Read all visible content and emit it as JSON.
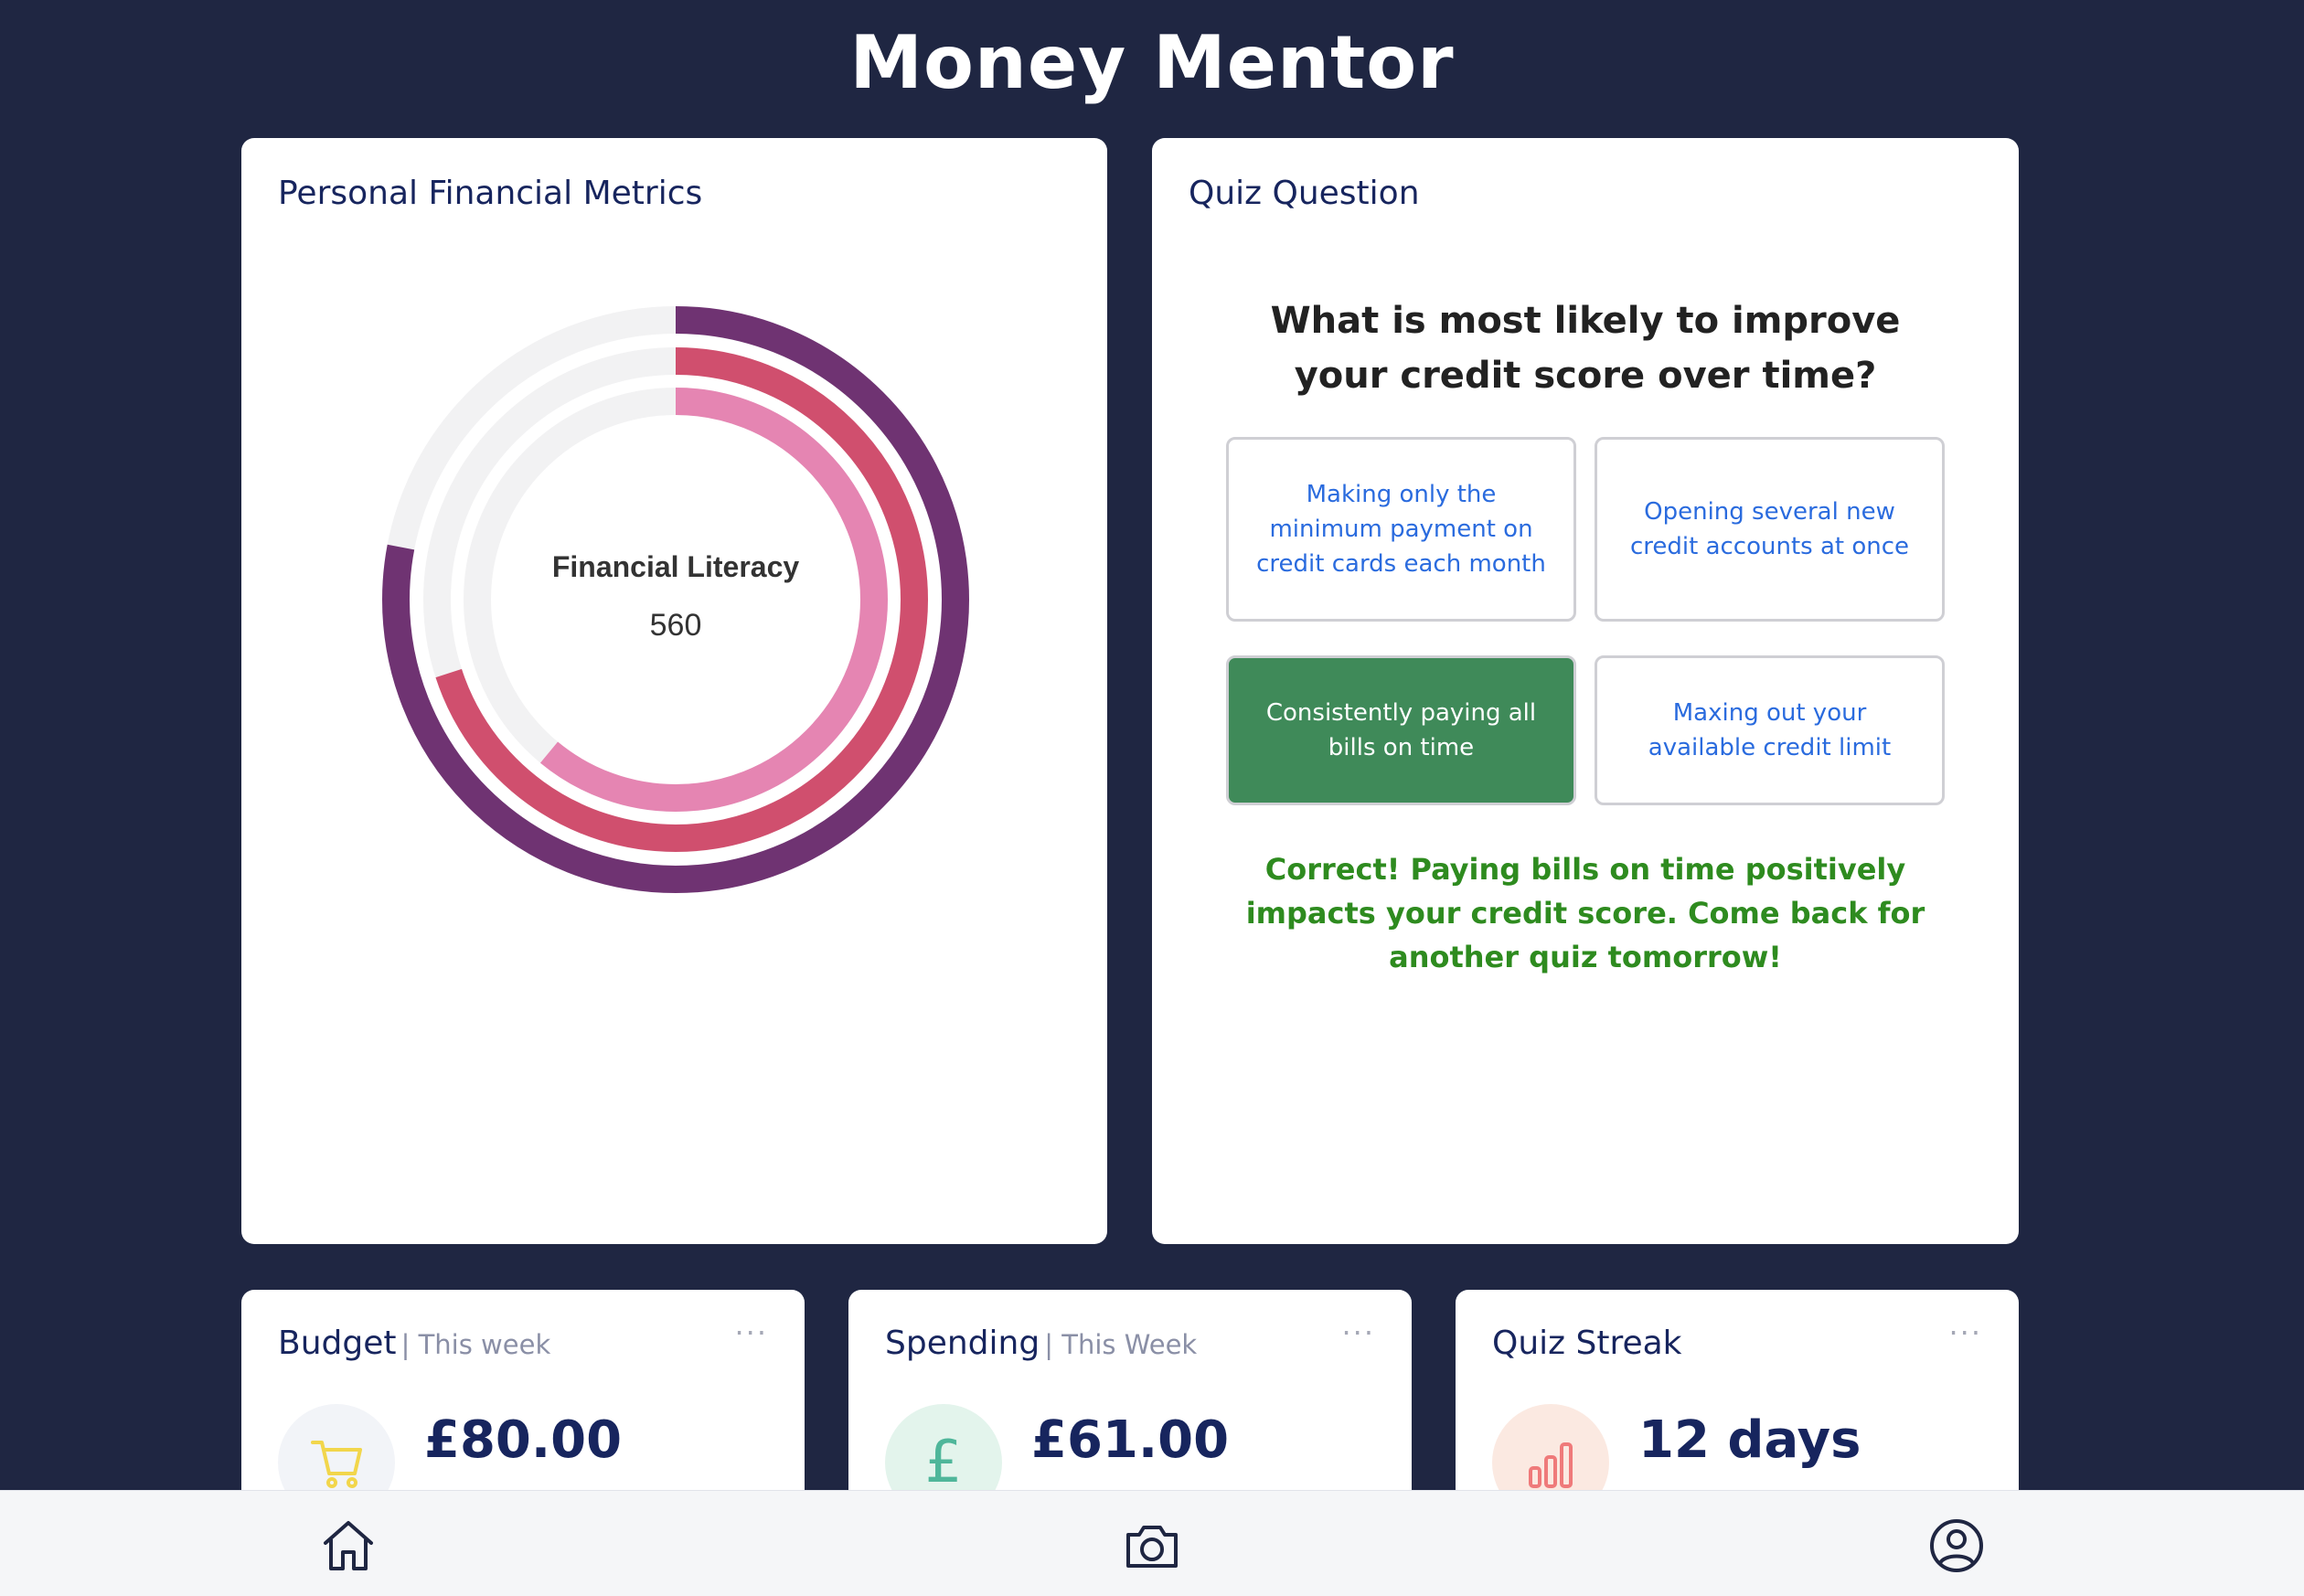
{
  "app": {
    "title": "Money Mentor"
  },
  "metrics": {
    "title": "Personal Financial Metrics",
    "center_label": "Financial Literacy",
    "center_value": "560",
    "rings": [
      {
        "fraction": 0.78,
        "color": "#6f3372"
      },
      {
        "fraction": 0.7,
        "color": "#d04f6e"
      },
      {
        "fraction": 0.61,
        "color": "#e585b2"
      }
    ],
    "track_color": "#f2f2f3"
  },
  "quiz": {
    "title": "Quiz Question",
    "question": "What is most likely to improve your credit score over time?",
    "options": [
      {
        "label": "Making only the minimum payment on credit cards each month"
      },
      {
        "label": "Opening several new credit accounts at once"
      },
      {
        "label": "Consistently paying all bills on time"
      },
      {
        "label": "Maxing out your available credit limit"
      }
    ],
    "selected_option": 2,
    "feedback": "Correct! Paying bills on time positively impacts your credit score. Come back for another quiz tomorrow!",
    "correct_color": "#3f8a59",
    "feedback_color": "#2e8b1f"
  },
  "budget": {
    "title": "Budget",
    "subtitle": "| This week",
    "value": "£80.00",
    "icon": "shopping-cart-icon"
  },
  "spending": {
    "title": "Spending",
    "subtitle": "| This Week",
    "value": "£61.00",
    "icon": "pound-sign-icon",
    "icon_glyph": "£"
  },
  "streak": {
    "title": "Quiz Streak",
    "value": "12 days",
    "icon": "bar-chart-icon"
  },
  "nav": {
    "items": [
      "home-icon",
      "camera-icon",
      "profile-icon"
    ]
  },
  "colors": {
    "background": "#1f2642",
    "heading": "#17255e",
    "option_text": "#2a6bde"
  }
}
